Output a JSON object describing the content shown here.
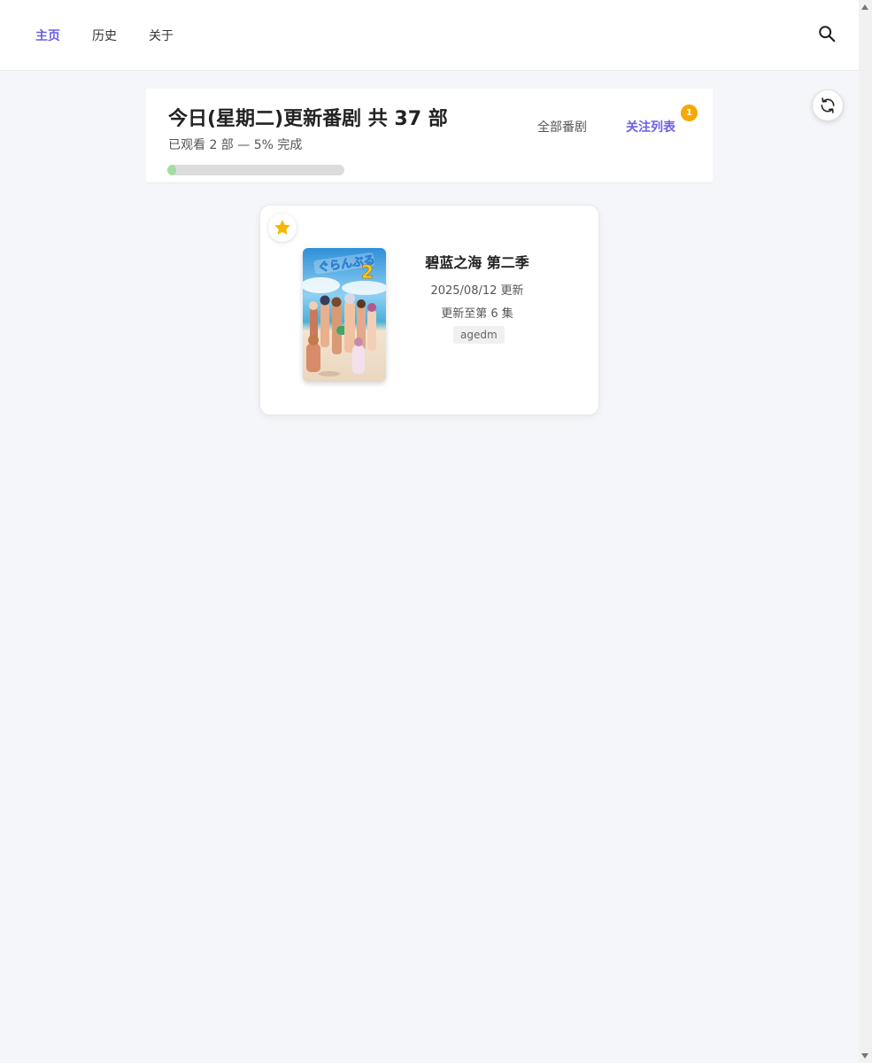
{
  "nav": {
    "items": [
      {
        "label": "主页",
        "active": true
      },
      {
        "label": "历史",
        "active": false
      },
      {
        "label": "关于",
        "active": false
      }
    ],
    "search_icon": "search-icon"
  },
  "header": {
    "title": "今日(星期二)更新番剧 共 37 部",
    "progress_text": "已观看 2 部 — 5% 完成",
    "progress_percent": 5,
    "tabs": [
      {
        "label": "全部番剧",
        "active": false
      },
      {
        "label": "关注列表",
        "active": true
      }
    ],
    "watchlist_badge": "1",
    "refresh_icon": "refresh-icon"
  },
  "anime": {
    "title": "碧蓝之海 第二季",
    "date": "2025/08/12 更新",
    "episode": "更新至第 6 集",
    "source": "agedm",
    "favorited": true,
    "cover_logo_text": "ぐらんぶる2"
  },
  "colors": {
    "accent": "#6a61e8",
    "badge": "#f5a800",
    "star": "#f5b800",
    "progress_fill": "#a5dca3",
    "progress_track": "#dcdcdc",
    "background": "#f5f6f9"
  }
}
